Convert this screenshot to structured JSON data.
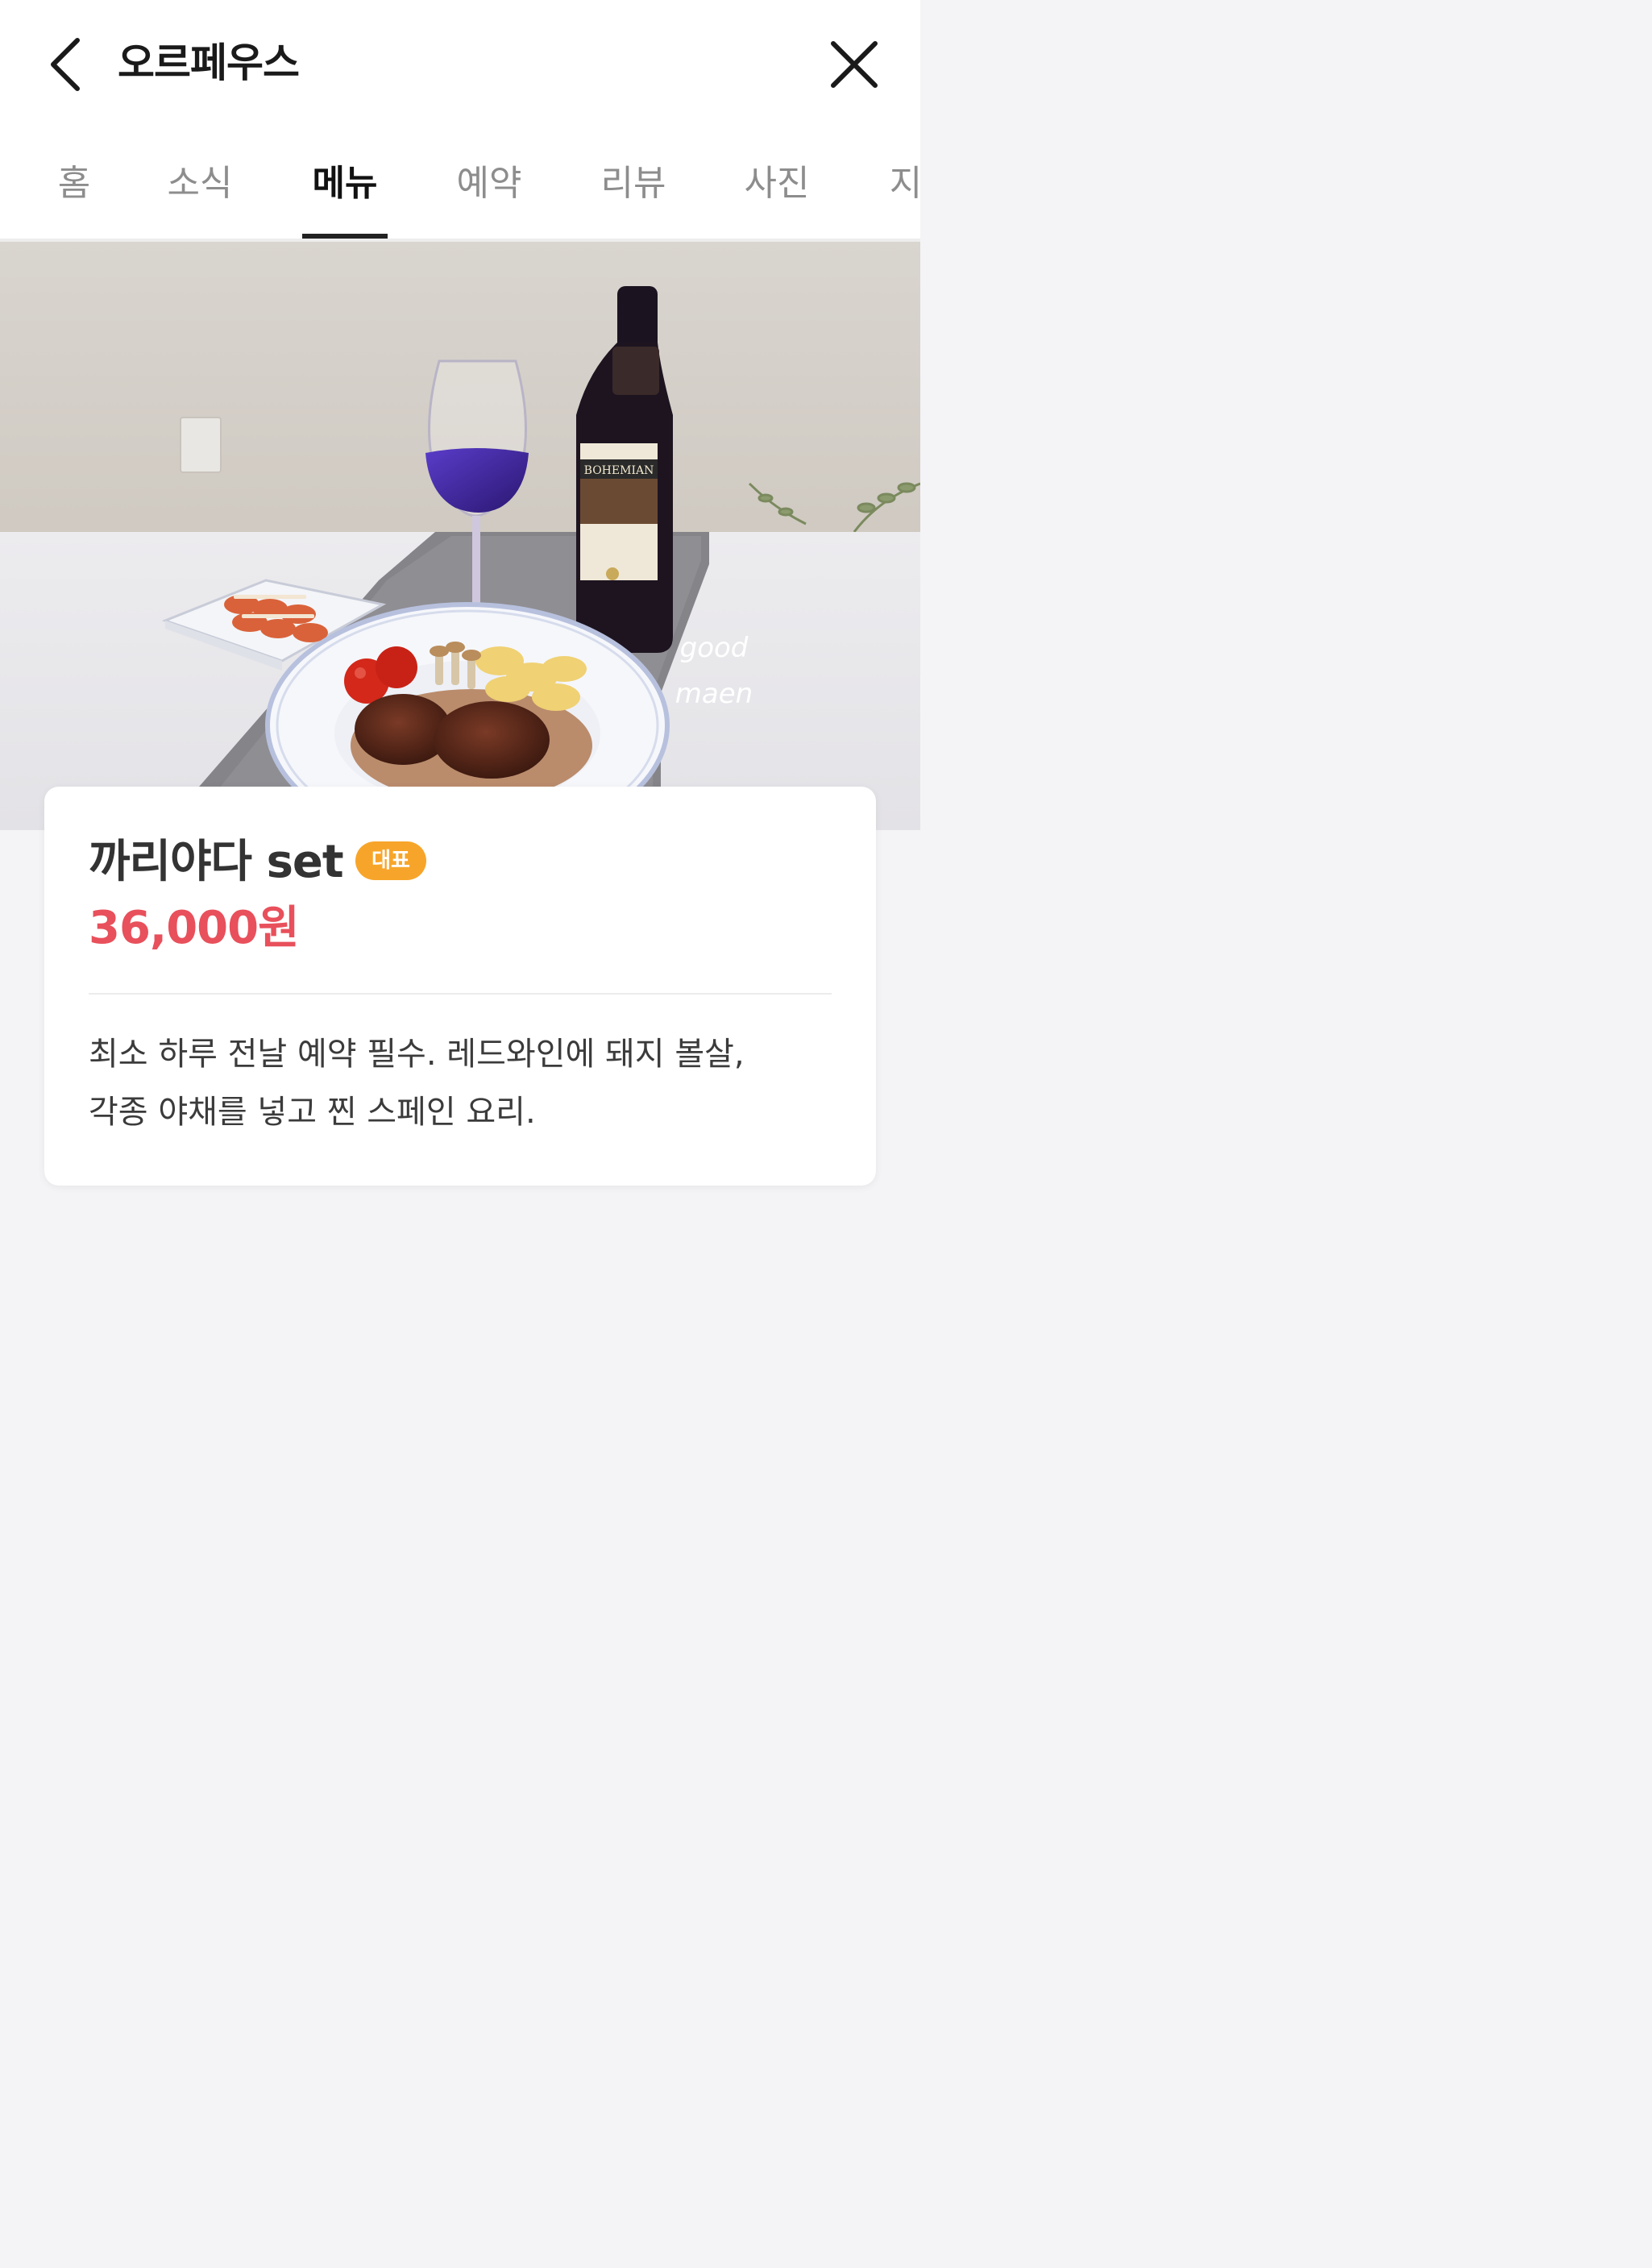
{
  "header": {
    "title": "오르페우스",
    "back_icon": "chevron-left-icon",
    "close_icon": "close-icon"
  },
  "tabs": [
    {
      "label": "홈",
      "active": false
    },
    {
      "label": "소식",
      "active": false
    },
    {
      "label": "메뉴",
      "active": true
    },
    {
      "label": "예약",
      "active": false
    },
    {
      "label": "리뷰",
      "active": false
    },
    {
      "label": "사진",
      "active": false
    },
    {
      "label": "지",
      "active": false
    }
  ],
  "hero": {
    "watermark_line1": "good",
    "watermark_line2": "maen",
    "wine_label": "BOHEMIAN"
  },
  "menu_item": {
    "name": "까리야다 set",
    "badge": "대표",
    "price": "36,000원",
    "description_line1": "최소 하루 전날 예약 필수. 레드와인에 돼지 볼살,",
    "description_line2": "각종 야채를 넣고 찐 스페인 요리."
  },
  "colors": {
    "price": "#e8505b",
    "badge_bg": "#f7a52a",
    "tab_active": "#111111",
    "tab_inactive": "#8d8d8d"
  }
}
